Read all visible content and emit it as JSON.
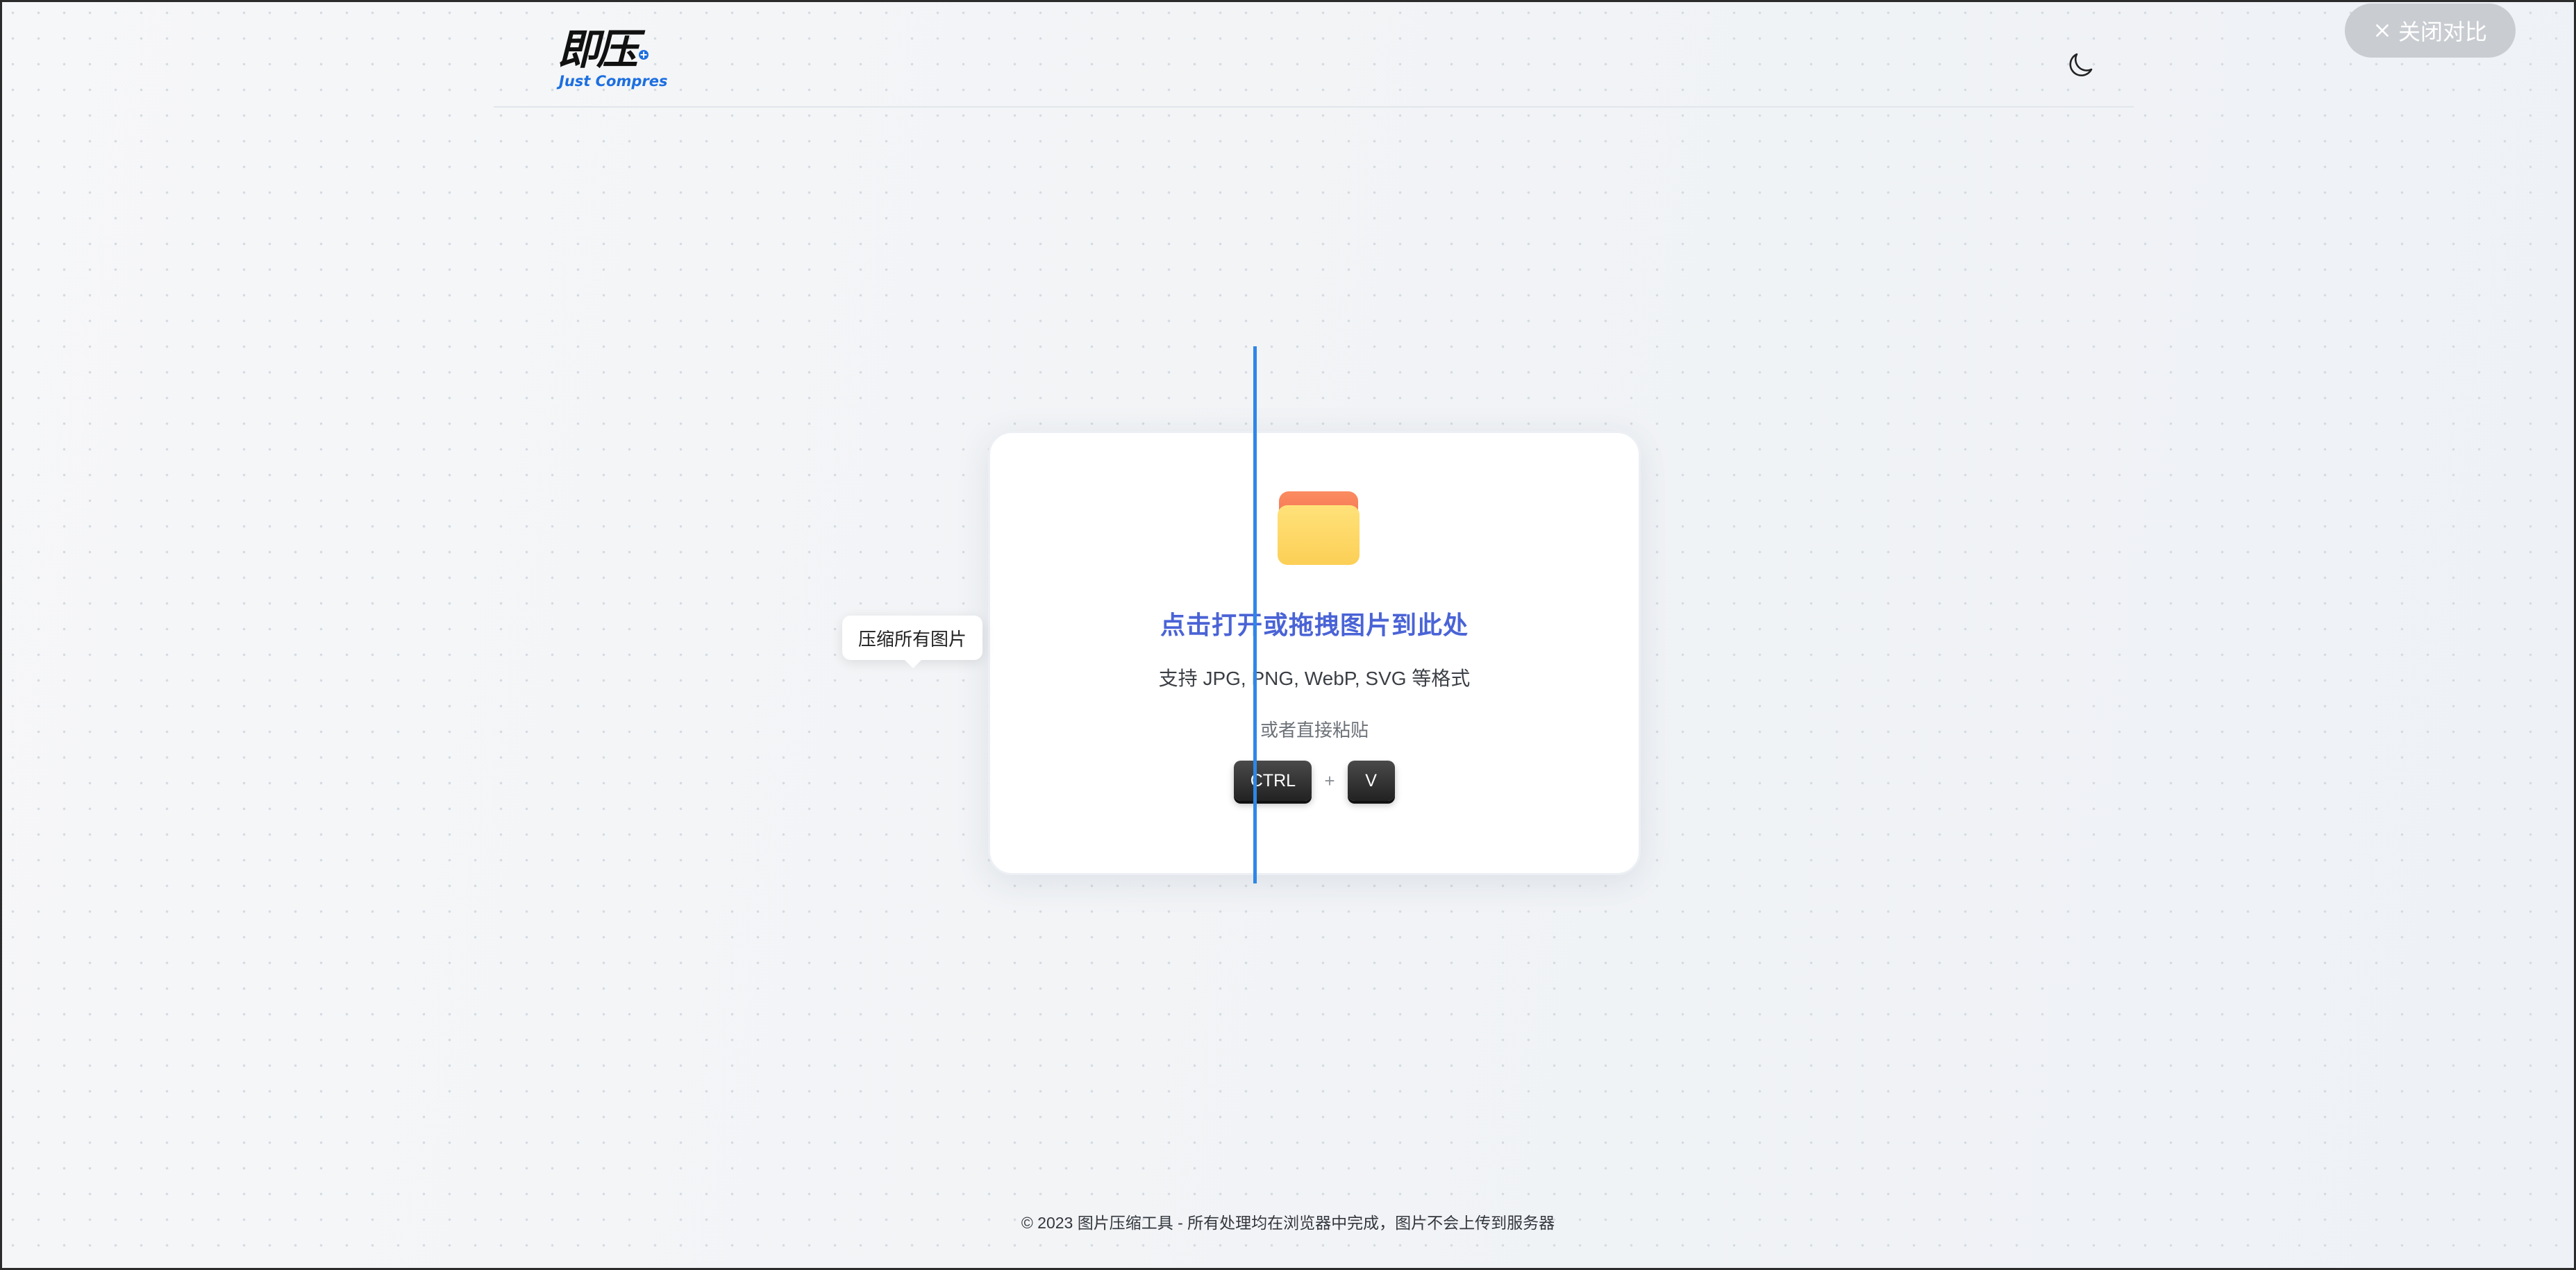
{
  "header": {
    "logo_text": "即压",
    "logo_subtext": "Just Compres"
  },
  "toolbar": {
    "close_compare_label": "关闭对比"
  },
  "dropzone": {
    "title": "点击打开或拖拽图片到此处",
    "formats": "支持 JPG, PNG, WebP, SVG 等格式",
    "paste_hint": "或者直接粘贴",
    "key_ctrl": "CTRL",
    "key_plus": "+",
    "key_v": "V"
  },
  "tooltip": {
    "text": "压缩所有图片"
  },
  "footer": {
    "text": "© 2023 图片压缩工具 - 所有处理均在浏览器中完成，图片不会上传到服务器"
  },
  "icons": {
    "theme": "moon-icon",
    "close": "close-icon",
    "folder": "folder-icon"
  },
  "colors": {
    "accent": "#4a63d6",
    "divider": "#2f86e8",
    "close_button_bg": "#c9ccd1",
    "folder_front": "#fdd66a",
    "folder_back": "#f9855a"
  }
}
